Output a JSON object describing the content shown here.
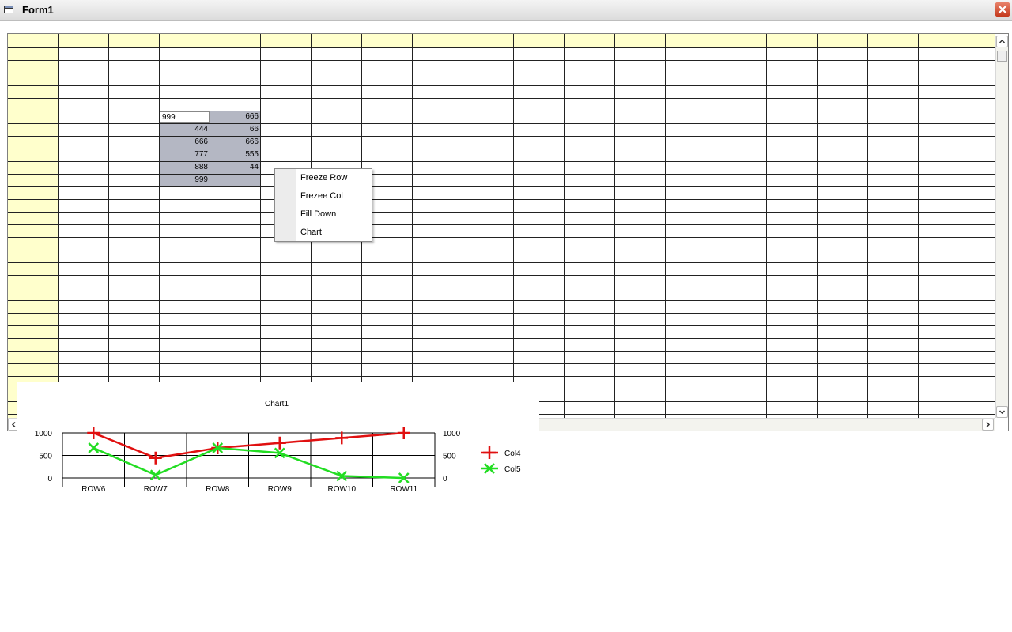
{
  "window": {
    "title": "Form1"
  },
  "grid": {
    "header_color": "#ffffcc",
    "selection_color": "#b4b7c3",
    "editing_value": "999",
    "values": [
      {
        "col": 4,
        "row": 6,
        "text": "666"
      },
      {
        "col": 3,
        "row": 7,
        "text": "444"
      },
      {
        "col": 4,
        "row": 7,
        "text": "66"
      },
      {
        "col": 3,
        "row": 8,
        "text": "666"
      },
      {
        "col": 4,
        "row": 8,
        "text": "666"
      },
      {
        "col": 3,
        "row": 9,
        "text": "777"
      },
      {
        "col": 4,
        "row": 9,
        "text": "555"
      },
      {
        "col": 3,
        "row": 10,
        "text": "888"
      },
      {
        "col": 4,
        "row": 10,
        "text": "44"
      },
      {
        "col": 3,
        "row": 11,
        "text": "999"
      }
    ]
  },
  "context_menu": {
    "items": [
      "Freeze Row",
      "Frezee Col",
      "Fill Down",
      "Chart"
    ]
  },
  "chart_data": {
    "type": "line",
    "title": "Chart1",
    "categories": [
      "ROW6",
      "ROW7",
      "ROW8",
      "ROW9",
      "ROW10",
      "ROW11"
    ],
    "series": [
      {
        "name": "Col4",
        "values": [
          999,
          444,
          666,
          777,
          888,
          999
        ],
        "color": "#e01010",
        "marker": "plus"
      },
      {
        "name": "Col5",
        "values": [
          666,
          66,
          666,
          555,
          44,
          0
        ],
        "color": "#22dd22",
        "marker": "x"
      }
    ],
    "ylim": [
      0,
      1000
    ],
    "yticks": [
      "1000",
      "500",
      "0"
    ],
    "yticks_right": [
      "1000",
      "500",
      "0"
    ],
    "grid": true,
    "legend": "right"
  }
}
